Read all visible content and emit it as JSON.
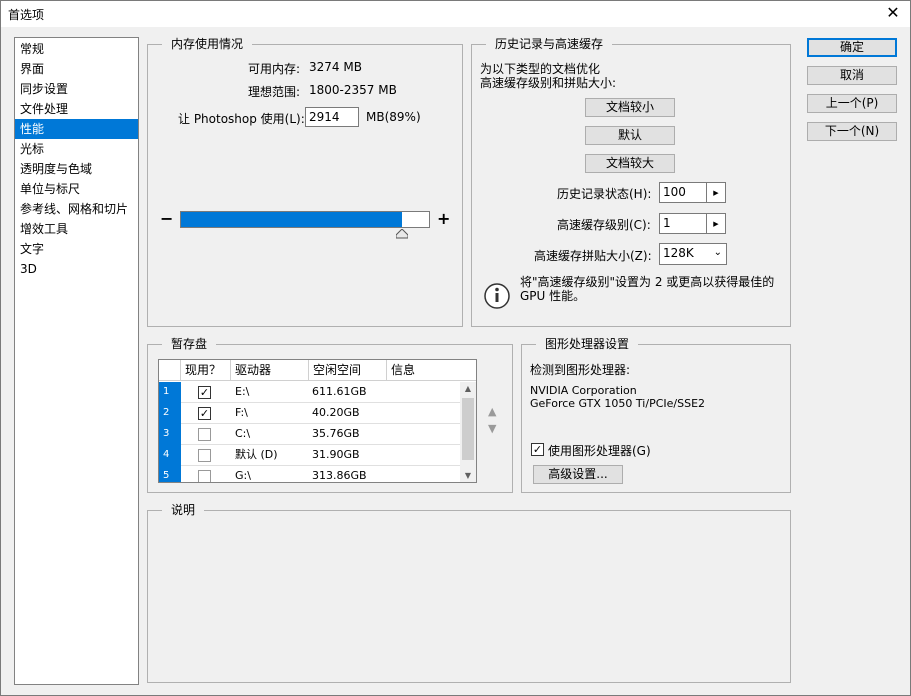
{
  "window": {
    "title": "首选项",
    "close_icon": "close-icon"
  },
  "nav": {
    "items": [
      {
        "label": "常规"
      },
      {
        "label": "界面"
      },
      {
        "label": "同步设置"
      },
      {
        "label": "文件处理"
      },
      {
        "label": "性能",
        "selected": true
      },
      {
        "label": "光标"
      },
      {
        "label": "透明度与色域"
      },
      {
        "label": "单位与标尺"
      },
      {
        "label": "参考线、网格和切片"
      },
      {
        "label": "增效工具"
      },
      {
        "label": "文字"
      },
      {
        "label": "3D"
      }
    ]
  },
  "memory": {
    "legend": "内存使用情况",
    "available_label": "可用内存:",
    "available_value": "3274 MB",
    "ideal_label": "理想范围:",
    "ideal_value": "1800-2357 MB",
    "use_label": "让 Photoshop 使用(L):",
    "use_value": "2914",
    "use_suffix": "MB(89%)",
    "slider_percent": 89,
    "minus": "−",
    "plus": "+"
  },
  "history": {
    "legend": "历史记录与高速缓存",
    "desc_line1": "为以下类型的文档优化",
    "desc_line2": "高速缓存级别和拼贴大小:",
    "btn_small": "文档较小",
    "btn_default": "默认",
    "btn_large": "文档较大",
    "states_label": "历史记录状态(H):",
    "states_value": "100",
    "levels_label": "高速缓存级别(C):",
    "levels_value": "1",
    "tile_label": "高速缓存拼贴大小(Z):",
    "tile_value": "128K",
    "info_icon": "info-icon",
    "info_line1": "将\"高速缓存级别\"设置为 2 或更高以获得最佳的",
    "info_line2": "GPU 性能。"
  },
  "scratch": {
    "legend": "暂存盘",
    "headers": [
      "现用？",
      "驱动器",
      "空闲空间",
      "信息"
    ],
    "rows": [
      {
        "num": "1",
        "checked": true,
        "drive": "E:\\",
        "free": "611.61GB"
      },
      {
        "num": "2",
        "checked": true,
        "drive": "F:\\",
        "free": "40.20GB"
      },
      {
        "num": "3",
        "checked": false,
        "drive": "C:\\",
        "free": "35.76GB"
      },
      {
        "num": "4",
        "checked": false,
        "drive": "默认 (D)",
        "free": "31.90GB"
      },
      {
        "num": "5",
        "checked": false,
        "drive": "G:\\",
        "free": "313.86GB"
      }
    ],
    "up_arrow": "▲",
    "down_arrow": "▼"
  },
  "gpu": {
    "legend": "图形处理器设置",
    "detected_label": "检测到图形处理器:",
    "vendor": "NVIDIA Corporation",
    "model": "GeForce GTX 1050 Ti/PCIe/SSE2",
    "use_gpu_label": "使用图形处理器(G)",
    "use_gpu_checked": true,
    "advanced_btn": "高级设置..."
  },
  "description": {
    "legend": "说明"
  },
  "buttons": {
    "ok": "确定",
    "cancel": "取消",
    "prev": "上一个(P)",
    "next": "下一个(N)"
  }
}
